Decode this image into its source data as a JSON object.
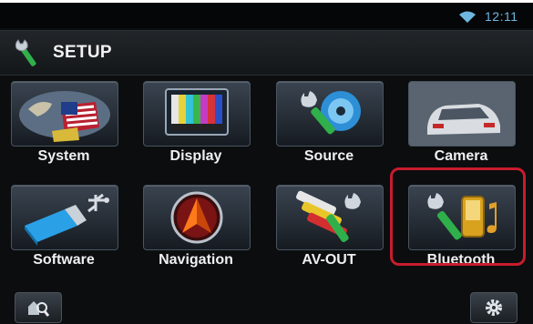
{
  "status_bar": {
    "clock": "12:11",
    "wifi_icon": "wifi-icon"
  },
  "header": {
    "title": "SETUP",
    "icon": "wrench-icon"
  },
  "tiles": [
    {
      "label": "System",
      "icon": "globe-flag-icon"
    },
    {
      "label": "Display",
      "icon": "color-bars-monitor-icon"
    },
    {
      "label": "Source",
      "icon": "wrench-disc-icon"
    },
    {
      "label": "Camera",
      "icon": "car-rear-icon"
    },
    {
      "label": "Software",
      "icon": "usb-drive-icon"
    },
    {
      "label": "Navigation",
      "icon": "compass-arrow-icon"
    },
    {
      "label": "AV-OUT",
      "icon": "rca-cables-icon"
    },
    {
      "label": "Bluetooth",
      "icon": "wrench-phone-music-icon"
    }
  ],
  "highlighted_tile": "Bluetooth",
  "bottom_bar": {
    "left_button_icon": "search-icon",
    "right_button_icon": "gear-icon"
  },
  "colors": {
    "accent": "#6fb6e0",
    "highlight": "#c81c2c",
    "background": "#0b0d0f"
  }
}
